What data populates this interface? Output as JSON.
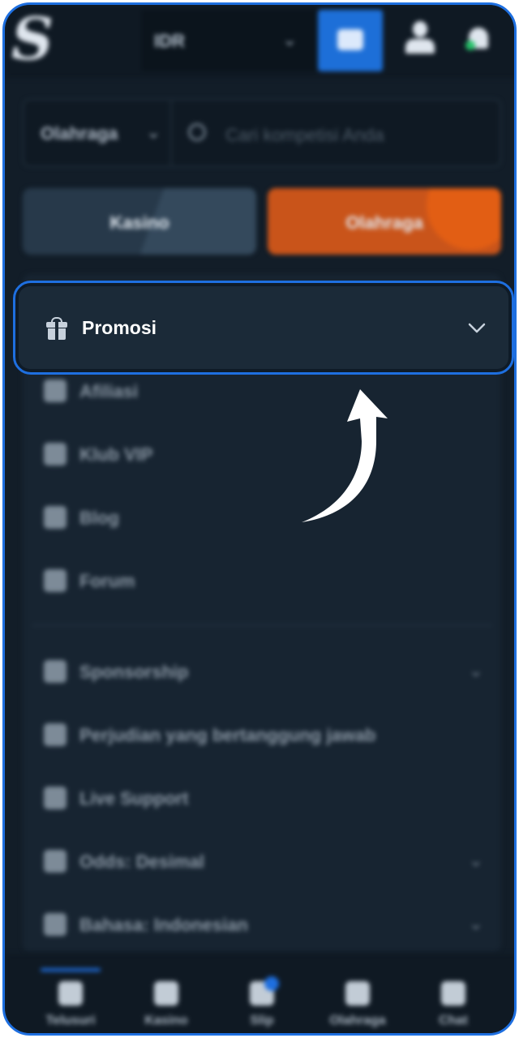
{
  "header": {
    "logo_text": "S",
    "currency": "IDR"
  },
  "search": {
    "category": "Olahraga",
    "placeholder": "Cari kompetisi Anda"
  },
  "tabs": [
    {
      "label": "Kasino"
    },
    {
      "label": "Olahraga"
    }
  ],
  "menu": {
    "promosi": "Promosi",
    "items": [
      {
        "label": "Afiliasi",
        "icon": "affiliate-icon"
      },
      {
        "label": "Klub VIP",
        "icon": "trophy-icon"
      },
      {
        "label": "Blog",
        "icon": "blog-icon"
      },
      {
        "label": "Forum",
        "icon": "forum-icon"
      },
      {
        "label": "Sponsorship",
        "icon": "sponsorship-icon"
      },
      {
        "label": "Perjudian yang bertanggung jawab",
        "icon": "shield-icon"
      },
      {
        "label": "Live Support",
        "icon": "headset-icon"
      },
      {
        "label": "Odds: Desimal",
        "icon": "odds-icon"
      },
      {
        "label": "Bahasa: Indonesian",
        "icon": "globe-icon"
      }
    ]
  },
  "bottom_nav": [
    {
      "label": "Telusuri"
    },
    {
      "label": "Kasino"
    },
    {
      "label": "Slip"
    },
    {
      "label": "Olahraga"
    },
    {
      "label": "Chat"
    }
  ],
  "colors": {
    "accent": "#1e6fe0",
    "background": "#121d28",
    "orange": "#c9541a"
  }
}
